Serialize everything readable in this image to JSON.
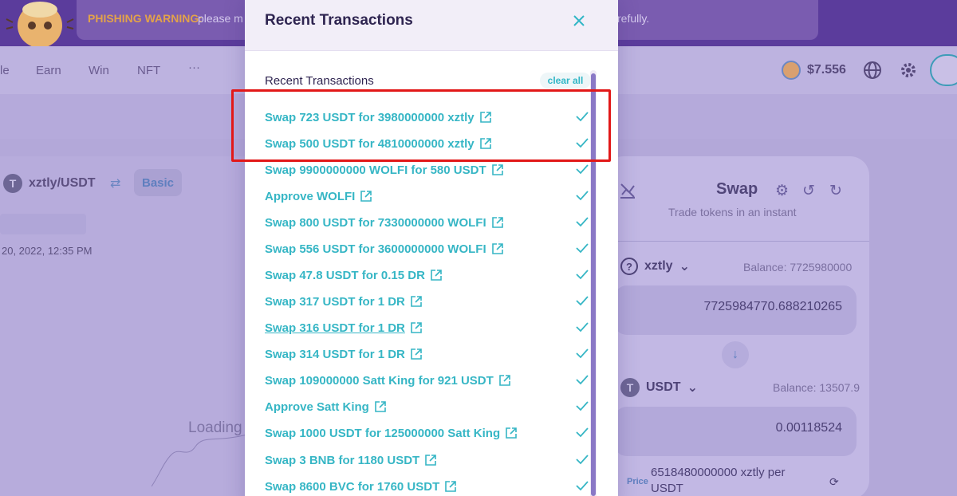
{
  "banner": {
    "title": "PHISHING WARNING:",
    "text_start": "please m",
    "text_end": "refully."
  },
  "nav": {
    "items": [
      "le",
      "Earn",
      "Win",
      "NFT",
      "···"
    ],
    "price": "$7.556",
    "icons": [
      "pancake-coin-icon",
      "globe-icon",
      "gear-icon",
      "wallet-icon"
    ]
  },
  "chart": {
    "pair": "xztly/USDT",
    "tab": "Basic",
    "date": "20, 2022, 12:35 PM",
    "loading": "Loading"
  },
  "swap": {
    "title": "Swap",
    "subtitle": "Trade tokens in an instant",
    "from_token": "xztly",
    "from_balance": "Balance: 7725980000",
    "from_amount": "7725984770.688210265",
    "to_token": "USDT",
    "to_balance": "Balance: 13507.9",
    "to_amount": "0.00118524",
    "price_label": "Price",
    "price_value": "6518480000000 xztly per USDT"
  },
  "modal": {
    "title": "Recent Transactions",
    "list_heading": "Recent Transactions",
    "clear_all": "clear all",
    "transactions": [
      "Swap 723 USDT for 3980000000 xztly",
      "Swap 500 USDT for 4810000000 xztly",
      "Swap 9900000000 WOLFI for 580 USDT",
      "Approve WOLFI",
      "Swap 800 USDT for 7330000000 WOLFI",
      "Swap 556 USDT for 3600000000 WOLFI",
      "Swap 47.8 USDT for 0.15 DR",
      "Swap 317 USDT for 1 DR",
      "Swap 316 USDT for 1 DR",
      "Swap 314 USDT for 1 DR",
      "Swap 109000000 Satt King for 921 USDT",
      "Approve Satt King",
      "Swap 1000 USDT for 125000000 Satt King",
      "Swap 3 BNB for 1180 USDT",
      "Swap 8600 BVC for 1760 USDT"
    ]
  },
  "colors": {
    "accent": "#36b6c5",
    "highlight": "#e21818",
    "scroll": "#8a78c6"
  }
}
